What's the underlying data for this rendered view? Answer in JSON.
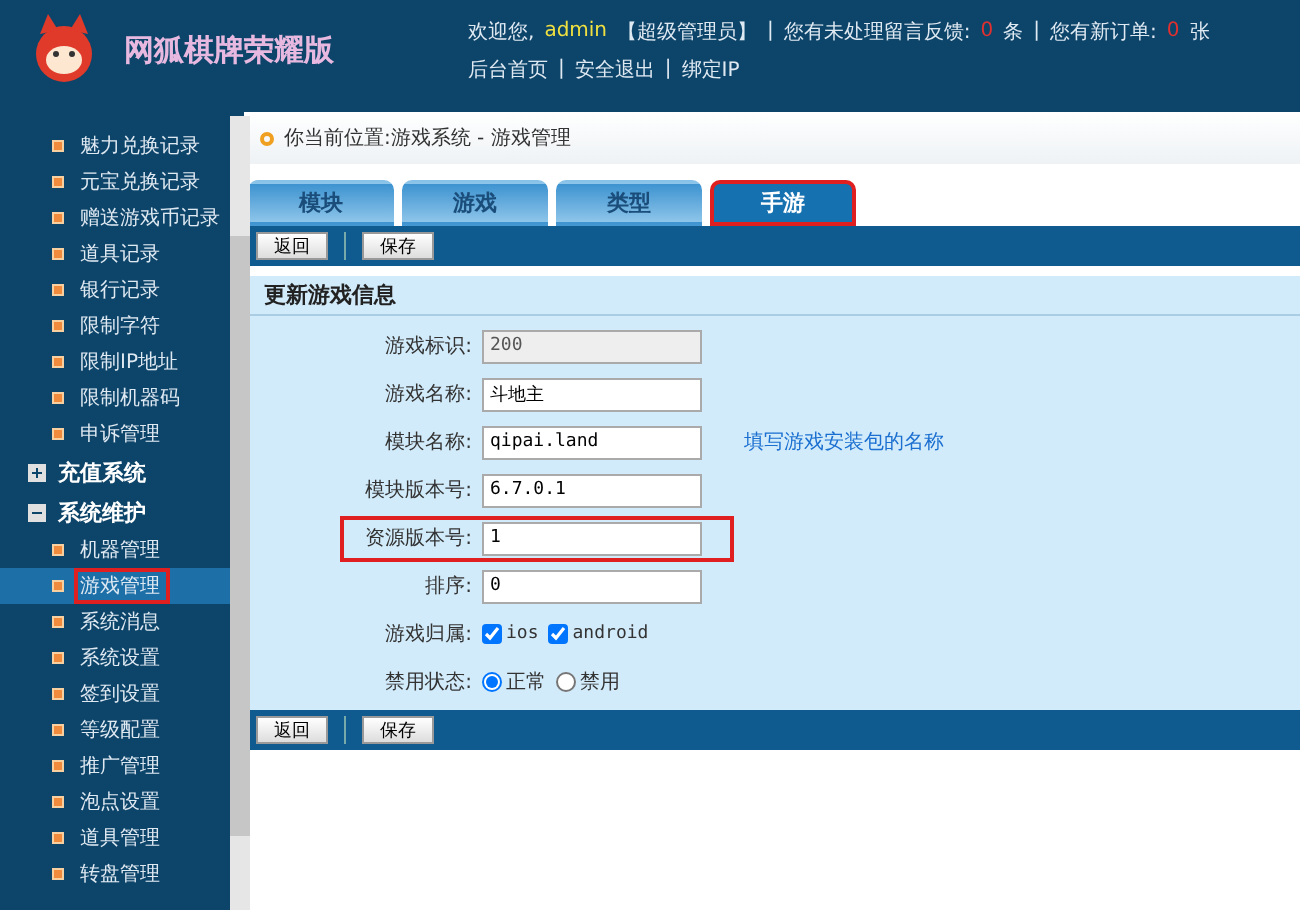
{
  "header": {
    "brand": "网狐棋牌荣耀版",
    "welcome": "欢迎您,",
    "user": "admin",
    "role": "【超级管理员】",
    "sep": "|",
    "feedback_label": "您有未处理留言反馈:",
    "feedback_count": "0",
    "feedback_unit": "条",
    "orders_label": "您有新订单:",
    "orders_count": "0",
    "orders_unit": "张",
    "links": [
      "后台首页",
      "安全退出",
      "绑定IP"
    ]
  },
  "sidebar": {
    "items": [
      {
        "kind": "item",
        "label": "魅力兑换记录",
        "selected": false,
        "highlighted": false
      },
      {
        "kind": "item",
        "label": "元宝兑换记录",
        "selected": false,
        "highlighted": false
      },
      {
        "kind": "item",
        "label": "赠送游戏币记录",
        "selected": false,
        "highlighted": false
      },
      {
        "kind": "item",
        "label": "道具记录",
        "selected": false,
        "highlighted": false
      },
      {
        "kind": "item",
        "label": "银行记录",
        "selected": false,
        "highlighted": false
      },
      {
        "kind": "item",
        "label": "限制字符",
        "selected": false,
        "highlighted": false
      },
      {
        "kind": "item",
        "label": "限制IP地址",
        "selected": false,
        "highlighted": false
      },
      {
        "kind": "item",
        "label": "限制机器码",
        "selected": false,
        "highlighted": false
      },
      {
        "kind": "item",
        "label": "申诉管理",
        "selected": false,
        "highlighted": false
      },
      {
        "kind": "group",
        "label": "充值系统",
        "expanded": false
      },
      {
        "kind": "group",
        "label": "系统维护",
        "expanded": true
      },
      {
        "kind": "item",
        "label": "机器管理",
        "selected": false,
        "highlighted": false
      },
      {
        "kind": "item",
        "label": "游戏管理",
        "selected": true,
        "highlighted": true
      },
      {
        "kind": "item",
        "label": "系统消息",
        "selected": false,
        "highlighted": false
      },
      {
        "kind": "item",
        "label": "系统设置",
        "selected": false,
        "highlighted": false
      },
      {
        "kind": "item",
        "label": "签到设置",
        "selected": false,
        "highlighted": false
      },
      {
        "kind": "item",
        "label": "等级配置",
        "selected": false,
        "highlighted": false
      },
      {
        "kind": "item",
        "label": "推广管理",
        "selected": false,
        "highlighted": false
      },
      {
        "kind": "item",
        "label": "泡点设置",
        "selected": false,
        "highlighted": false
      },
      {
        "kind": "item",
        "label": "道具管理",
        "selected": false,
        "highlighted": false
      },
      {
        "kind": "item",
        "label": "转盘管理",
        "selected": false,
        "highlighted": false
      }
    ]
  },
  "breadcrumb": "你当前位置:游戏系统 - 游戏管理",
  "tabs": [
    {
      "label": "模块",
      "selected": false,
      "highlighted": false
    },
    {
      "label": "游戏",
      "selected": false,
      "highlighted": false
    },
    {
      "label": "类型",
      "selected": false,
      "highlighted": false
    },
    {
      "label": "手游",
      "selected": true,
      "highlighted": true
    }
  ],
  "toolbar_buttons": [
    "返回",
    "保存"
  ],
  "section_title": "更新游戏信息",
  "form": [
    {
      "kind": "text",
      "label": "游戏标识:",
      "value": "200",
      "disabled": true,
      "highlighted": false
    },
    {
      "kind": "text",
      "label": "游戏名称:",
      "value": "斗地主",
      "disabled": false,
      "highlighted": false
    },
    {
      "kind": "text",
      "label": "模块名称:",
      "value": "qipai.land",
      "disabled": false,
      "highlighted": false,
      "hint": "填写游戏安装包的名称"
    },
    {
      "kind": "text",
      "label": "模块版本号:",
      "value": "6.7.0.1",
      "disabled": false,
      "highlighted": false
    },
    {
      "kind": "text",
      "label": "资源版本号:",
      "value": "1",
      "disabled": false,
      "highlighted": true
    },
    {
      "kind": "text",
      "label": "排序:",
      "value": "0",
      "disabled": false,
      "highlighted": false
    },
    {
      "kind": "checks",
      "label": "游戏归属:",
      "options": [
        {
          "label": "ios",
          "checked": true
        },
        {
          "label": "android",
          "checked": true
        }
      ]
    },
    {
      "kind": "radios",
      "label": "禁用状态:",
      "options": [
        {
          "label": "正常",
          "selected": true
        },
        {
          "label": "禁用",
          "selected": false
        }
      ]
    }
  ],
  "bottom_buttons": [
    "返回",
    "保存"
  ]
}
